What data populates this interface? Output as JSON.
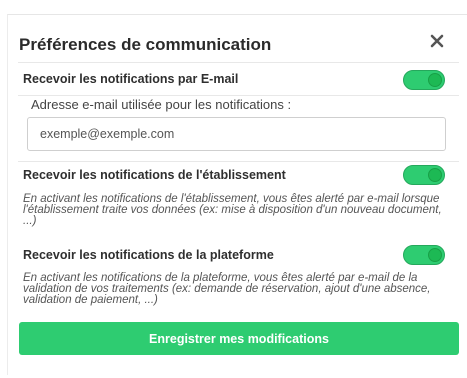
{
  "modal": {
    "title": "Préférences de communication",
    "close_icon": "close-icon"
  },
  "email_section": {
    "label": "Recevoir les notifications par E-mail",
    "enabled": true,
    "caption": "Adresse e-mail utilisée pour les notifications :",
    "input_placeholder": "exemple@exemple.com",
    "input_value": ""
  },
  "establishment_section": {
    "label": "Recevoir les notifications de l'établissement",
    "enabled": true,
    "description": "En activant les notifications de l'établissement, vous êtes alerté par e-mail lorsque l'établissement traite vos données (ex: mise à disposition d'un nouveau document, ...)"
  },
  "platform_section": {
    "label": "Recevoir les notifications de la plateforme",
    "enabled": true,
    "description": "En activant les notifications de la plateforme, vous êtes alerté par e-mail de la validation de vos traitements (ex: demande de réservation, ajout d'une absence, validation de paiement, ...)"
  },
  "actions": {
    "save_label": "Enregistrer mes modifications"
  },
  "colors": {
    "accent": "#2ecc71",
    "title_text": "#2b2b2b"
  }
}
